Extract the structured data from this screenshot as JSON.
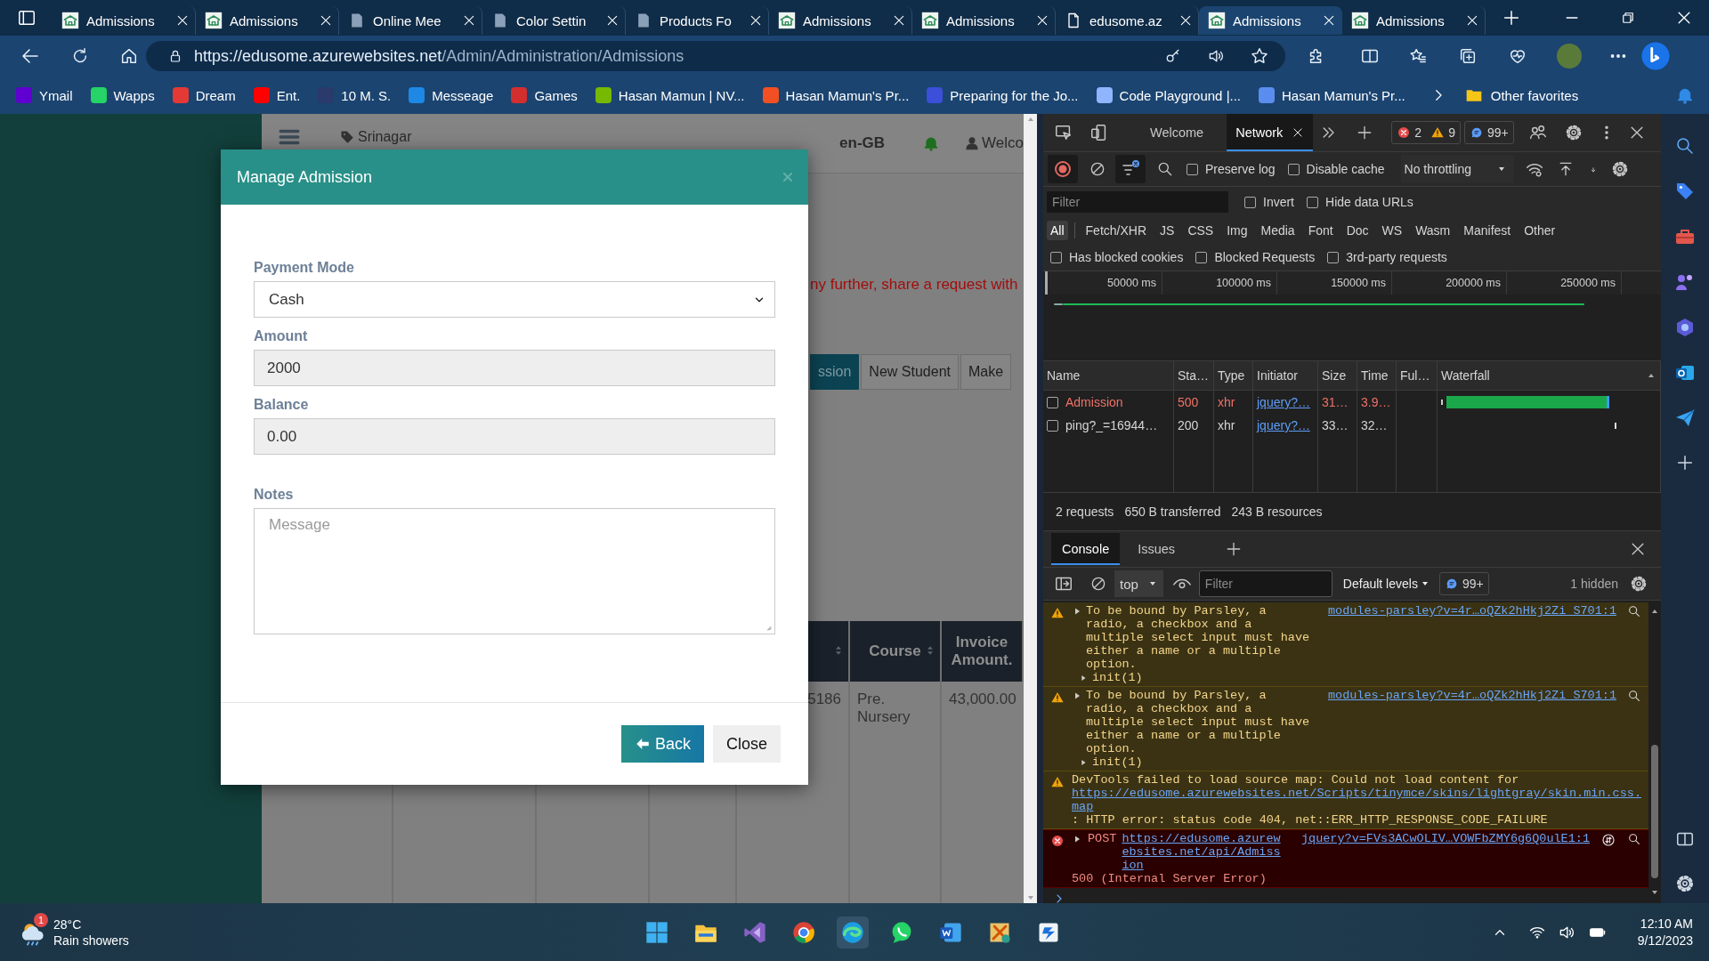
{
  "browser": {
    "tabs": [
      {
        "title": "Admissions",
        "kind": "site",
        "selected": false
      },
      {
        "title": "Admissions",
        "kind": "site",
        "selected": false
      },
      {
        "title": "Online Mee",
        "kind": "page",
        "selected": false
      },
      {
        "title": "Color Settin",
        "kind": "page",
        "selected": false
      },
      {
        "title": "Products Fo",
        "kind": "page",
        "selected": false
      },
      {
        "title": "Admissions",
        "kind": "site",
        "selected": false
      },
      {
        "title": "Admissions",
        "kind": "site",
        "selected": false
      },
      {
        "title": "edusome.az",
        "kind": "file",
        "selected": false
      },
      {
        "title": "Admissions",
        "kind": "site",
        "selected": true
      },
      {
        "title": "Admissions",
        "kind": "site",
        "selected": false
      }
    ],
    "address": {
      "host": "https://edusome.azurewebsites.net",
      "path": "/Admin/Administration/Admissions"
    },
    "bookmarks": [
      {
        "label": "Ymail",
        "color": "#6001d2"
      },
      {
        "label": "Wapps",
        "color": "#25d366"
      },
      {
        "label": "Dream",
        "color": "#e53935"
      },
      {
        "label": "Ent.",
        "color": "#ff0000"
      },
      {
        "label": "10 M. S.",
        "color": "#2a3a6a"
      },
      {
        "label": "Messeage",
        "color": "#1e88e5"
      },
      {
        "label": "Games",
        "color": "#d32f2f"
      },
      {
        "label": "Hasan Mamun | NV...",
        "color": "#76b900"
      },
      {
        "label": "Hasan Mamun's Pr...",
        "color": "#f25022"
      },
      {
        "label": "Preparing for the Jo...",
        "color": "#3b4fd8"
      },
      {
        "label": "Code Playground |...",
        "color": "#8fb5ff"
      },
      {
        "label": "Hasan Mamun's Pr...",
        "color": "#5b8def"
      }
    ],
    "other_favorites": "Other favorites"
  },
  "page": {
    "location": "Srinagar",
    "language": "en-GB",
    "greeting": "Welco",
    "notice": "ny further, share a request with",
    "tabs": [
      {
        "label": "ssion",
        "selected": true
      },
      {
        "label": "New Student",
        "selected": false
      },
      {
        "label": "Make",
        "selected": false
      }
    ],
    "table": {
      "columns": [
        null,
        "Course",
        "Invoice Amount."
      ],
      "rows": [
        [
          "5186",
          "Pre. Nursery",
          "43,000.00"
        ]
      ]
    }
  },
  "modal": {
    "title": "Manage Admission",
    "fields": [
      {
        "kind": "select",
        "label": "Payment Mode",
        "value": "Cash",
        "readonly": false
      },
      {
        "kind": "input",
        "label": "Amount",
        "value": "2000",
        "readonly": true
      },
      {
        "kind": "input",
        "label": "Balance",
        "value": "0.00",
        "readonly": true
      },
      {
        "kind": "textarea",
        "label": "Notes",
        "placeholder": "Message",
        "readonly": false
      }
    ],
    "buttons": [
      {
        "label": "Back",
        "kind": "primary"
      },
      {
        "label": "Close",
        "kind": "default"
      }
    ]
  },
  "devtools": {
    "tabs": [
      {
        "label": "Welcome",
        "selected": false
      },
      {
        "label": "Network",
        "selected": true
      }
    ],
    "errors": "2",
    "warnings": "9",
    "messages": "99+",
    "network": {
      "toggles": [
        {
          "label": "Preserve log",
          "checked": false
        },
        {
          "label": "Disable cache",
          "checked": false
        }
      ],
      "throttling": "No throttling",
      "filter_placeholder": "Filter",
      "filter_toggles": [
        {
          "label": "Invert",
          "checked": false
        },
        {
          "label": "Hide data URLs",
          "checked": false
        }
      ],
      "types": [
        {
          "label": "All",
          "selected": true
        },
        {
          "label": "Fetch/XHR",
          "selected": false
        },
        {
          "label": "JS",
          "selected": false
        },
        {
          "label": "CSS",
          "selected": false
        },
        {
          "label": "Img",
          "selected": false
        },
        {
          "label": "Media",
          "selected": false
        },
        {
          "label": "Font",
          "selected": false
        },
        {
          "label": "Doc",
          "selected": false
        },
        {
          "label": "WS",
          "selected": false
        },
        {
          "label": "Wasm",
          "selected": false
        },
        {
          "label": "Manifest",
          "selected": false
        },
        {
          "label": "Other",
          "selected": false
        }
      ],
      "options": [
        {
          "label": "Has blocked cookies",
          "checked": false
        },
        {
          "label": "Blocked Requests",
          "checked": false
        },
        {
          "label": "3rd-party requests",
          "checked": false
        }
      ],
      "ticks": [
        "50000 ms",
        "100000 ms",
        "150000 ms",
        "200000 ms",
        "250000 ms"
      ],
      "columns": [
        "Name",
        "Sta…",
        "Type",
        "Initiator",
        "Size",
        "Time",
        "Ful…",
        "Waterfall"
      ],
      "rows": [
        {
          "name": "Admission",
          "status": "500",
          "type": "xhr",
          "initiator": "jquery?…",
          "size": "31…",
          "time": "3.9…",
          "failed": true,
          "checked": false
        },
        {
          "name": "ping?_=16944…",
          "status": "200",
          "type": "xhr",
          "initiator": "jquery?…",
          "size": "33…",
          "time": "32…",
          "failed": false,
          "checked": false
        }
      ],
      "summary": [
        "2 requests",
        "650 B transferred",
        "243 B resources"
      ]
    },
    "console": {
      "tabs": [
        {
          "label": "Console",
          "selected": true
        },
        {
          "label": "Issues",
          "selected": false
        }
      ],
      "context": "top",
      "filter_placeholder": "Filter",
      "levels": "Default levels",
      "count": "99+",
      "hidden": "1 hidden",
      "messages": [
        {
          "kind": "warning",
          "text": "To be bound by Parsley, a radio, a checkbox and a\nmultiple select input must have either a name or a multiple option.",
          "source": "modules-parsley?v=4r…oQZk2hHkj2Zi_S701:1",
          "trace": "init(1)"
        },
        {
          "kind": "warning",
          "text": "To be bound by Parsley, a radio, a checkbox and a\nmultiple select input must have either a name or a multiple option.",
          "source": "modules-parsley?v=4r…oQZk2hHkj2Zi_S701:1",
          "trace": "init(1)"
        },
        {
          "kind": "warning",
          "text": "DevTools failed to load source map: Could not load content for",
          "link": "https://edusome.azurewebsites.net/Scripts/tinymce/skins/lightgray/skin.min.css.map",
          "after": ": HTTP error: status code 404, net::ERR_HTTP_RESPONSE_CODE_FAILURE"
        },
        {
          "kind": "error",
          "text": "POST",
          "link": "https://edusome.azurewebsites.net/api/Admission",
          "after": "500 (Internal Server Error)",
          "source": "jquery?v=FVs3ACwOLIV…VOWFbZMY6g6Q0ulE1:1"
        }
      ]
    }
  },
  "taskbar": {
    "weather": {
      "badge": "1",
      "temperature": "28°C",
      "condition": "Rain showers"
    },
    "time": "12:10 AM",
    "date": "9/12/2023"
  }
}
